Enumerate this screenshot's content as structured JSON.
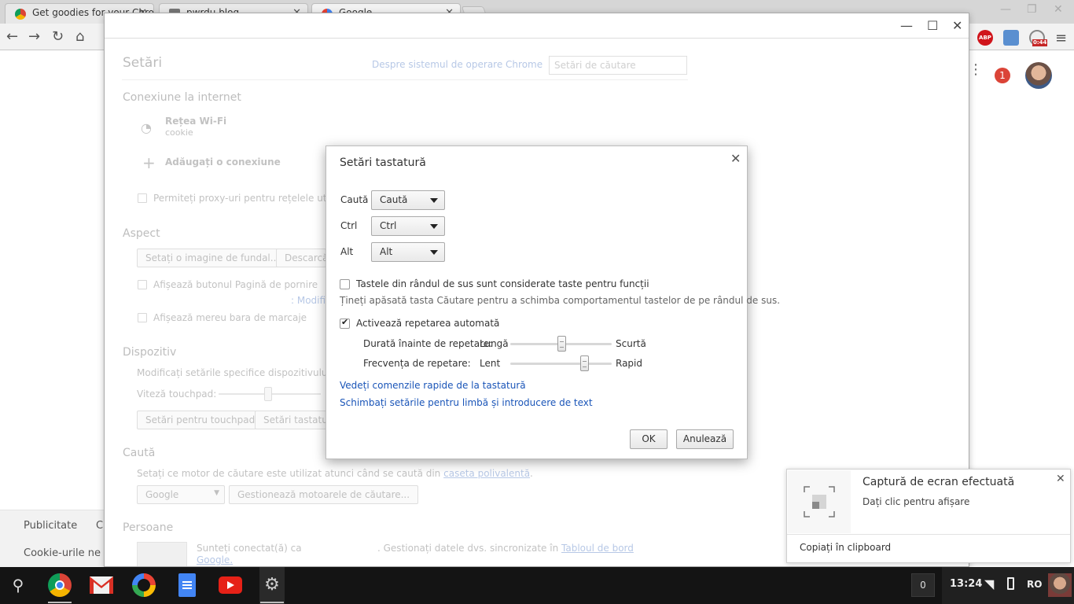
{
  "browser": {
    "tabs": [
      {
        "label": "Get goodies for your Chro",
        "active": false,
        "icon": "chrome-icon"
      },
      {
        "label": "pwrdu blog",
        "active": false,
        "icon": "blog-icon"
      },
      {
        "label": "Google",
        "active": true,
        "icon": "google-icon"
      }
    ],
    "extension_badge": "0:44",
    "abp_label": "ABP",
    "notification_count": "1"
  },
  "google_footer": {
    "advertising": "Publicitate",
    "cookie_text": "Cookie-urile ne aju",
    "partial_link": "C"
  },
  "settings": {
    "title": "Setări",
    "about_link": "Despre sistemul de operare Chrome",
    "search_placeholder": "Setări de căutare",
    "internet": {
      "heading": "Conexiune la internet",
      "wifi_label": "Rețea Wi-Fi",
      "wifi_network": "cookie",
      "add_connection": "Adăugați o conexiune",
      "proxy_checkbox": "Permiteți proxy-uri pentru rețelele utilizat"
    },
    "appearance": {
      "heading": "Aspect",
      "set_wallpaper": "Setați o imagine de fundal...",
      "download_btn": "Descarcă",
      "home_button": "Afișează butonul Pagină de pornire",
      "modify_link": ": Modific",
      "bookmarks_bar": "Afișează mereu bara de marcaje"
    },
    "device": {
      "heading": "Dispozitiv",
      "description": "Modificați setările specifice dispozitivului și p",
      "touchpad_speed": "Viteză touchpad:",
      "touchpad_btn": "Setări pentru touchpad",
      "keyboard_btn": "Setări tastatură"
    },
    "search": {
      "heading": "Caută",
      "description": "Setați ce motor de căutare este utilizat atunci când se caută din",
      "omnibox_link": "caseta polivalentă",
      "engine": "Google",
      "manage_btn": "Gestionează motoarele de căutare..."
    },
    "people": {
      "heading": "Persoane",
      "signed_in": "Sunteți conectat(ă) ca",
      "manage_sync": ". Gestionați datele dvs. sincronizate în",
      "dashboard_link": "Tabloul de bord",
      "google_link": "Google"
    }
  },
  "dialog": {
    "title": "Setări tastatură",
    "rows": [
      {
        "label": "Caută",
        "value": "Caută"
      },
      {
        "label": "Ctrl",
        "value": "Ctrl"
      },
      {
        "label": "Alt",
        "value": "Alt"
      }
    ],
    "top_row_checkbox": "Tastele din rândul de sus sunt considerate taste pentru funcții",
    "top_row_hint": "Țineți apăsată tasta Căutare pentru a schimba comportamentul tastelor de pe rândul de sus.",
    "auto_repeat_checkbox": "Activează repetarea automată",
    "delay_label": "Durată înainte de repetare:",
    "delay_min": "Lungă",
    "delay_max": "Scurtă",
    "delay_value": 0.5,
    "rate_label": "Frecvența de repetare:",
    "rate_min": "Lent",
    "rate_max": "Rapid",
    "rate_value": 0.73,
    "shortcuts_link": "Vedeți comenzile rapide de la tastatură",
    "language_link": "Schimbați setările pentru limbă și introducere de text",
    "ok": "OK",
    "cancel": "Anulează"
  },
  "notification": {
    "title": "Captură de ecran efectuată",
    "message": "Dați clic pentru afișare",
    "action": "Copiați în clipboard"
  },
  "shelf": {
    "notification_count": "0",
    "clock": "13:24",
    "language": "RO"
  },
  "colors": {
    "link": "#1a55b8",
    "shelf": "#141414",
    "abp": "#d0141b",
    "badge": "#db4437"
  }
}
